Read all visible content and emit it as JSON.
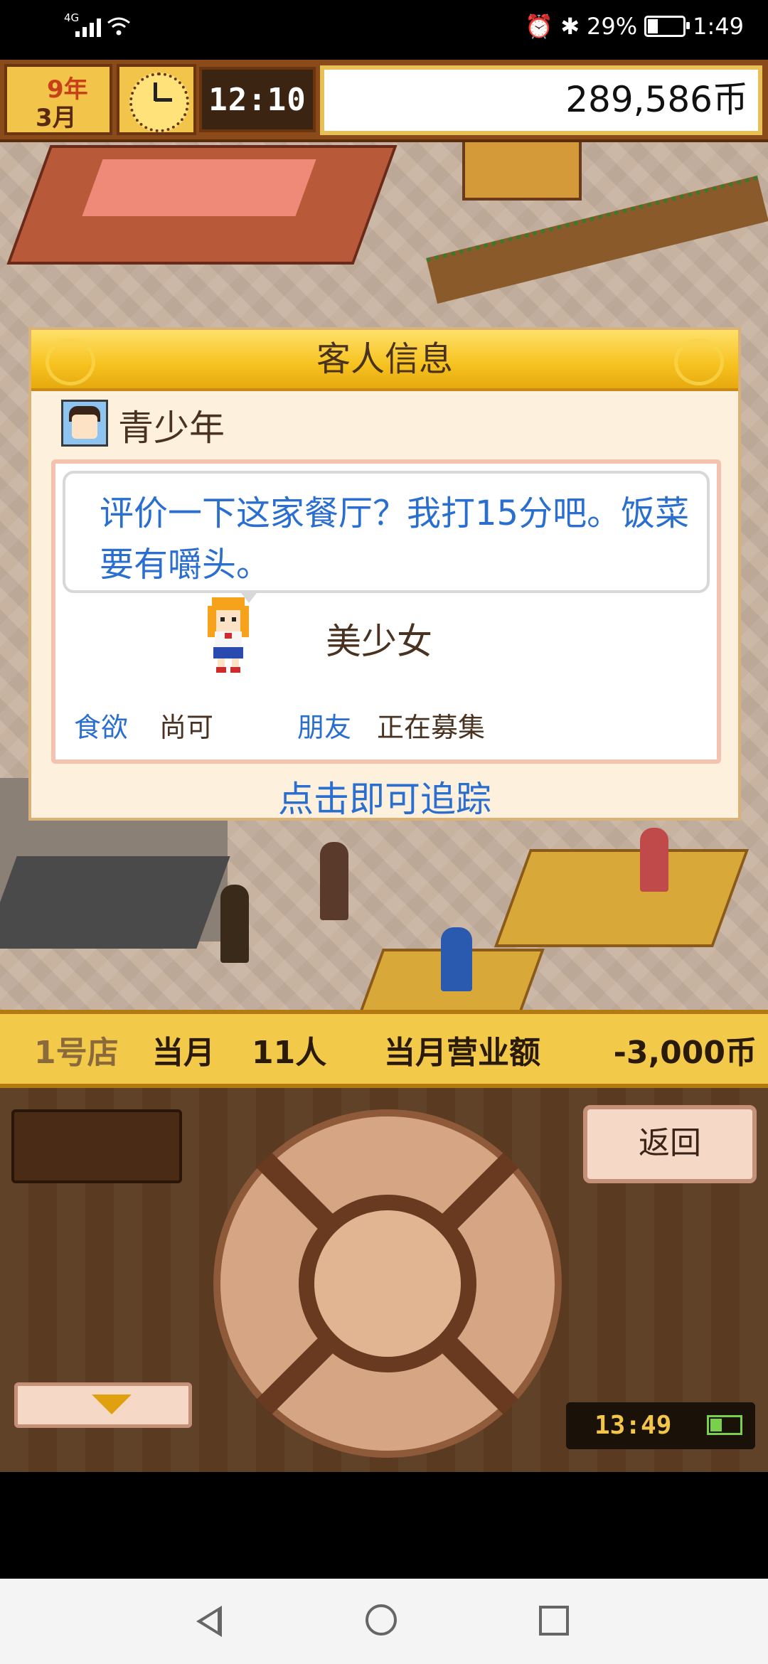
{
  "status_bar": {
    "network": "4G",
    "battery": "29%",
    "time": "1:49"
  },
  "hud": {
    "year_num": "9",
    "year_unit": "年",
    "month_num": "3",
    "month_unit": "月",
    "game_time": "12:10",
    "money": "289,586币"
  },
  "modal": {
    "title": "客人信息",
    "customer_type": "青少年",
    "review": "评价一下这家餐厅？我打15分吧。饭菜要有嚼头。",
    "tag": "美少女",
    "stats": [
      {
        "label": "食欲",
        "color": "#2a6fd0"
      },
      {
        "label": "尚可",
        "color": "#4a3220"
      },
      {
        "label": "朋友",
        "color": "#2a6fd0"
      },
      {
        "label": "正在募集",
        "color": "#4a3220"
      }
    ],
    "trace_hint": "点击即可追踪"
  },
  "strip": {
    "store": "1号店",
    "month": "当月",
    "count": "11人",
    "revenue_label": "当月营业额",
    "revenue_value": "-3,000币"
  },
  "controls": {
    "back_label": "返回",
    "clock": "13:49"
  },
  "colors": {
    "accent_gold": "#f6c21f",
    "link_blue": "#2a6fd0",
    "text_brown": "#4a3220"
  }
}
